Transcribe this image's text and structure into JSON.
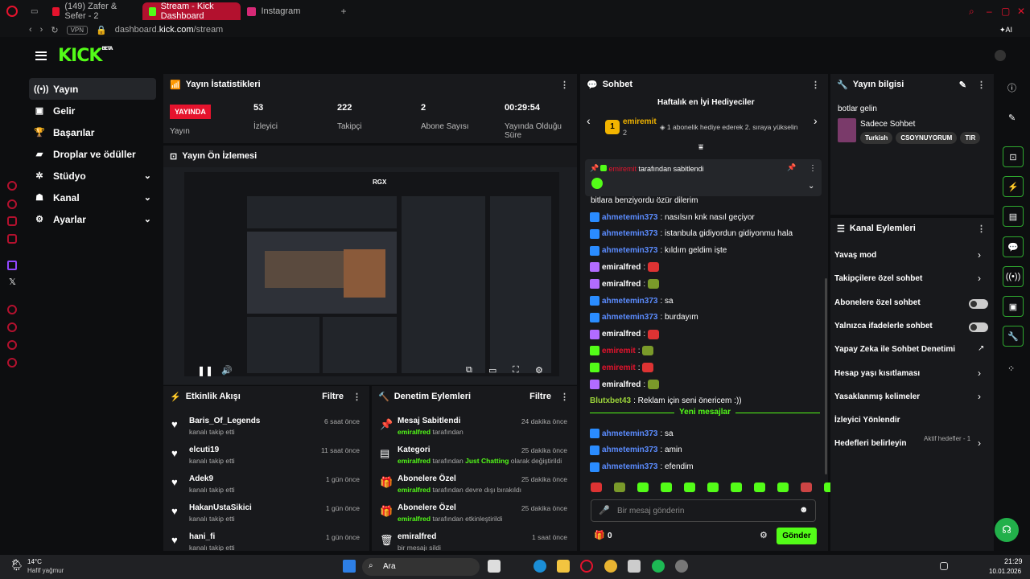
{
  "browser": {
    "tabs": [
      {
        "label": "(149) Zafer & Sefer - 2",
        "color": "#e5132d"
      },
      {
        "label": "Stream - Kick Dashboard",
        "color": "#53fc18"
      },
      {
        "label": "Instagram",
        "color": "#d62976"
      }
    ],
    "url_prefix": "dashboard.",
    "url_host": "kick.com",
    "url_path": "/stream",
    "vpn": "VPN",
    "ai": "AI"
  },
  "header": {
    "logo": "KICK",
    "beta": "BETA"
  },
  "nav": {
    "items": [
      {
        "label": "Yayın",
        "icon": "((•))"
      },
      {
        "label": "Gelir",
        "icon": "▣"
      },
      {
        "label": "Başarılar",
        "icon": "🏆"
      },
      {
        "label": "Droplar ve ödüller",
        "icon": "▰"
      },
      {
        "label": "Stüdyo",
        "icon": "✲",
        "chev": "⌄"
      },
      {
        "label": "Kanal",
        "icon": "☗",
        "chev": "⌄"
      },
      {
        "label": "Ayarlar",
        "icon": "⚙",
        "chev": "⌄"
      }
    ]
  },
  "stats": {
    "title": "Yayın İstatistikleri",
    "live": "YAYINDA",
    "live_label": "Yayın",
    "viewers": "53",
    "viewers_label": "İzleyici",
    "followers": "222",
    "followers_label": "Takipçi",
    "subs": "2",
    "subs_label": "Abone Sayısı",
    "uptime": "00:29:54",
    "uptime_label": "Yayında Olduğu Süre"
  },
  "preview": {
    "title": "Yayın Ön İzlemesi",
    "rgx": "RGX"
  },
  "activity": {
    "title": "Etkinlik Akışı",
    "filter": "Filtre",
    "rows": [
      {
        "name": "Baris_Of_Legends",
        "action": "kanalı takip etti",
        "time": "6 saat önce"
      },
      {
        "name": "elcuti19",
        "action": "kanalı takip etti",
        "time": "11 saat önce"
      },
      {
        "name": "Adek9",
        "action": "kanalı takip etti",
        "time": "1 gün önce"
      },
      {
        "name": "HakanUstaSikici",
        "action": "kanalı takip etti",
        "time": "1 gün önce"
      },
      {
        "name": "hani_fi",
        "action": "kanalı takip etti",
        "time": "1 gün önce"
      }
    ]
  },
  "moderation": {
    "title": "Denetim Eylemleri",
    "filter": "Filtre",
    "rows": [
      {
        "icon": "📌",
        "title": "Mesaj Sabitlendi",
        "user": "emiralfred",
        "rest": " tarafından",
        "extra": "",
        "extra2": "",
        "time": "24 dakika önce"
      },
      {
        "icon": "▤",
        "title": "Kategori",
        "user": "emiralfred",
        "rest": " tarafından ",
        "extra": "Just Chatting",
        "extra2": " olarak değiştirildi",
        "time": "25 dakika önce"
      },
      {
        "icon": "🎁",
        "title": "Abonelere Özel",
        "user": "emiralfred",
        "rest": " tarafından devre dışı bırakıldı",
        "extra": "",
        "extra2": "",
        "time": "25 dakika önce"
      },
      {
        "icon": "🎁",
        "title": "Abonelere Özel",
        "user": "emiralfred",
        "rest": " tarafından etkinleştirildi",
        "extra": "",
        "extra2": "",
        "time": "25 dakika önce"
      },
      {
        "icon": "🗑",
        "title": "emiralfred",
        "user": "",
        "rest": "bir mesajı sildi",
        "extra": "",
        "extra2": "",
        "time": "1 saat önce"
      }
    ]
  },
  "chat": {
    "title": "Sohbet",
    "gifters_title": "Haftalık en İyi Hediyeciler",
    "gifter_name": "emiremit",
    "gifter_count": "2",
    "gifter_rank": "1",
    "gifter_tip": "1 abonelik hediye ederek 2. sıraya yükselin",
    "pinned_user": "emiremit",
    "pinned_text": "tarafından sabitlendi",
    "first_line": "bitlara benziyordu özür dilerim",
    "new_messages": "Yeni mesajlar",
    "placeholder": "Bir mesaj gönderin",
    "send": "Gönder",
    "count": "0",
    "messages": [
      {
        "user": "ahmetemin373",
        "text": ": nasılsın knk nasıl geçiyor",
        "color": "#5b8cff",
        "emote": false
      },
      {
        "user": "ahmetemin373",
        "text": ": istanbula gidiyordun gidiyonmu hala",
        "color": "#5b8cff",
        "emote": false
      },
      {
        "user": "ahmetemin373",
        "text": ": kıldım geldim işte",
        "color": "#5b8cff",
        "emote": false
      },
      {
        "user": "emiralfred",
        "text": ":",
        "color": "#ffffff",
        "emote": true
      },
      {
        "user": "emiralfred",
        "text": ":",
        "color": "#ffffff",
        "emote": true
      },
      {
        "user": "ahmetemin373",
        "text": ": sa",
        "color": "#5b8cff",
        "emote": false
      },
      {
        "user": "ahmetemin373",
        "text": ": burdayım",
        "color": "#5b8cff",
        "emote": false
      },
      {
        "user": "emiralfred",
        "text": ":",
        "color": "#ffffff",
        "emote": true
      },
      {
        "user": "emiremit",
        "text": ":",
        "color": "#e5132d",
        "emote": true
      },
      {
        "user": "emiremit",
        "text": ":",
        "color": "#e5132d",
        "emote": true
      },
      {
        "user": "emiralfred",
        "text": ":",
        "color": "#ffffff",
        "emote": true
      },
      {
        "user": "Blutxbet43",
        "text": ": Reklam için seni önericem :))",
        "color": "#9bd33a",
        "emote": false
      }
    ],
    "new": [
      {
        "user": "ahmetemin373",
        "text": ": sa"
      },
      {
        "user": "ahmetemin373",
        "text": ": amin"
      },
      {
        "user": "ahmetemin373",
        "text": ": efendim"
      }
    ]
  },
  "info": {
    "title": "Yayın bilgisi",
    "stream_title": "botlar gelin",
    "category": "Sadece Sohbet",
    "tags": [
      "Turkish",
      "CSOYNUYORUM",
      "TIR"
    ]
  },
  "channel_actions": {
    "title": "Kanal Eylemleri",
    "items": [
      {
        "label": "Yavaş mod",
        "type": "chev"
      },
      {
        "label": "Takipçilere özel sohbet",
        "type": "chev"
      },
      {
        "label": "Abonelere özel sohbet",
        "type": "toggle"
      },
      {
        "label": "Yalnızca ifadelerle sohbet",
        "type": "toggle"
      },
      {
        "label": "Yapay Zeka ile Sohbet Denetimi",
        "type": "ext"
      },
      {
        "label": "Hesap yaşı kısıtlaması",
        "type": "chev"
      },
      {
        "label": "Yasaklanmış kelimeler",
        "type": "chev"
      },
      {
        "label": "İzleyici Yönlendir",
        "type": "none"
      },
      {
        "label": "Hedefleri belirleyin",
        "type": "chev"
      }
    ],
    "goals_status": "Aktif hedefler - 1"
  },
  "taskbar": {
    "temp": "14°C",
    "weather": "Hafif yağmur",
    "search": "Ara",
    "time": "21:29",
    "date": "10.01.2026"
  },
  "colors": {
    "accent": "#53fc18",
    "live": "#e5132d",
    "panel": "#18191c",
    "bg": "#0d0e10"
  }
}
